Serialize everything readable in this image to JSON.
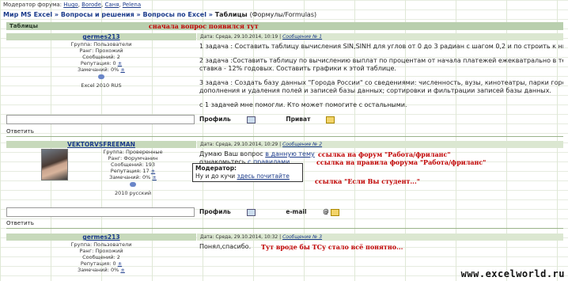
{
  "moderator": {
    "label": "Модератор форума:",
    "names": [
      "Hugo",
      "Borode",
      "Саня",
      "Pelena"
    ]
  },
  "breadcrumb": {
    "items": [
      "Мир MS Excel",
      "Вопросы и решения",
      "Вопросы по Excel"
    ],
    "current": "Таблицы",
    "sub": "(Формулы/Formulas)",
    "sep": "»"
  },
  "section": {
    "title": "Таблицы"
  },
  "posts": [
    {
      "author": "germes213",
      "meta": "Дата: Среда, 29.10.2014, 10:19",
      "msg_link": "Сообщение № 1",
      "group": "Группа: Пользователи",
      "rank": "Ранг: Прохожий",
      "messages": "Сообщений: 2",
      "reputation": "Репутация: 0",
      "warnings": "Замечаний: 0%",
      "plus": "±",
      "software": "Excel 2010 RUS",
      "body": [
        "1 задача : Составить таблицу вычисления SIN,SINH для углов от 0 до 3 радиан с шагом 0,2 и по строить к ним",
        "2 задача :Составить таблицу по вычислению выплат по процентам от начала платежей ежекватрально в течен",
        "ставка - 12% годовых. Составить графики к этой таблице.",
        "3 задача : Создать базу данных \"Города России\" со сведениями: численность, вузы, кинотеатры, парки город",
        "дополнения и удаления полей и записей базы данных; сортировки и фильтрации записей базы данных.",
        "с 1 задачей мне помогли. Кто может помогите с остальными."
      ],
      "footer": {
        "profile": "Профиль",
        "private": "Приват"
      }
    },
    {
      "author": "VEKTORVSFREEMAN",
      "meta": "Дата: Среда, 29.10.2014, 10:29",
      "msg_link": "Сообщение № 2",
      "group": "Группа: Проверенные",
      "rank": "Ранг: Форумчанин",
      "messages": "Сообщений: 193",
      "reputation": "Репутация: 17",
      "warnings": "Замечаний: 0%",
      "plus": "±",
      "software": "2010 русский",
      "body_line1_pre": "Думаю Ваш вопрос ",
      "body_line1_link": "в данную тему",
      "body_line2_pre": "ознакомьтесь ",
      "body_line2_link": "с правилами",
      "tooltip": {
        "title": "Модератор:",
        "pre": "Ну и до кучи ",
        "link": "здесь почитайте"
      },
      "footer": {
        "profile": "Профиль",
        "email": "e-mail"
      }
    },
    {
      "author": "germes213",
      "meta": "Дата: Среда, 29.10.2014, 10:32",
      "msg_link": "Сообщение № 3",
      "group": "Группа: Пользователи",
      "rank": "Ранг: Прохожий",
      "messages": "Сообщений: 2",
      "reputation": "Репутация: 0",
      "warnings": "Замечаний: 0%",
      "plus": "±",
      "body": "Понял,спасибо."
    }
  ],
  "reply_label": "Ответить",
  "annotations": {
    "first_question": "сначала вопрос появился тут",
    "forum_link": "ссылка на форум \"Работа/фриланс\"",
    "rules_link": "ссылка на правила форума \"Работа/фриланс\"",
    "student_link": "ссылка \"Если Вы студент...\"",
    "ts_note": "Тут вроде бы ТСу стало всё понятно..."
  },
  "watermark": "www.excelworld.ru",
  "colors": {
    "header_green": "#b9cfae",
    "link_blue": "#1a3a8a",
    "annotation_red": "#c00000"
  }
}
